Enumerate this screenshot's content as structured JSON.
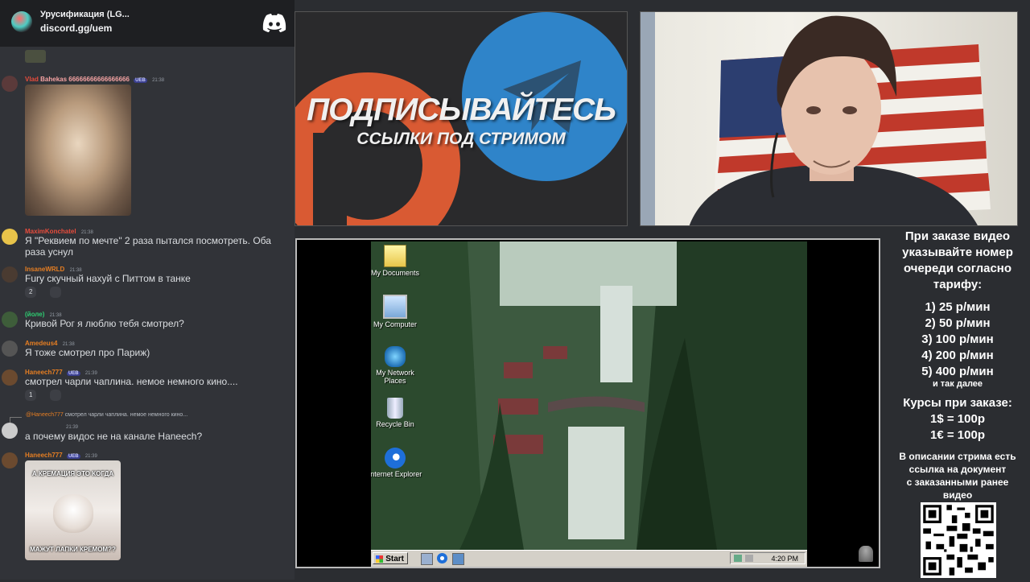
{
  "chat": {
    "server_name": "Урусификация (LG...",
    "invite": "discord.gg/uem",
    "messages": [
      {
        "user": "Vlad",
        "user_rest": "Bahekas 66666666666666666",
        "time": "21:38",
        "color": "#e74c3c",
        "badge": "UEB"
      },
      {
        "user": "MaximKonchatel",
        "time": "21:38",
        "color": "#e74c3c",
        "text": "Я \"Реквием по мечте\" 2 раза пытался посмотреть. Оба",
        "text2": "раза уснул"
      },
      {
        "user": "InsaneWRLD",
        "time": "21:38",
        "color": "#e67e22",
        "text": "Fury скучный нахуй с Питтом в танке",
        "reaction": "2"
      },
      {
        "user": "(йоле)",
        "time": "21:38",
        "color": "#2ecc71",
        "text": "Кривой Рог я люблю тебя смотрел?"
      },
      {
        "user": "Amedeus4",
        "time": "21:38",
        "color": "#e67e22",
        "text": "Я тоже смотрел про Париж)"
      },
      {
        "user": "Haneech777",
        "time": "21:39",
        "color": "#e67e22",
        "badge": "UEB",
        "text": "смотрел чарли чаплина. немое немного кино....",
        "reaction": "1"
      },
      {
        "reply_user": "@Haneech777",
        "reply_text": "смотрел чарли чаплина. немое немного кино...",
        "time": "21:39",
        "text": "а почему видос не на канале Haneech?"
      },
      {
        "user": "Haneech777",
        "time": "21:39",
        "color": "#e67e22",
        "badge": "UEB",
        "image_top": "А КРЕМАЦИЯ ЭТО КОГДА",
        "image_bottom": "МАЖУТ ЛАПКИ КРЕМОМ??"
      }
    ]
  },
  "promo": {
    "title": "ПОДПИСЫВАЙТЕСЬ",
    "subtitle": "ССЫЛКИ ПОД СТРИМОМ"
  },
  "desktop": {
    "icons": [
      "My Documents",
      "My Computer",
      "My Network Places",
      "Recycle Bin",
      "Internet Explorer"
    ],
    "start_label": "Start",
    "clock": "4:20 PM"
  },
  "info": {
    "heading": [
      "При заказе видео",
      "указывайте номер",
      "очереди согласно",
      "тарифу:"
    ],
    "tariffs": [
      "1) 25 р/мин",
      "2) 50 р/мин",
      "3) 100 р/мин",
      "4) 200 р/мин",
      "5) 400 р/мин"
    ],
    "etc": "и так далее",
    "rates_title": "Курсы при заказе:",
    "rates": [
      "1$ = 100р",
      "1€ = 100р"
    ],
    "description": [
      "В описании стрима есть",
      "ссылка на документ",
      "с заказанными ранее",
      "видео"
    ]
  }
}
